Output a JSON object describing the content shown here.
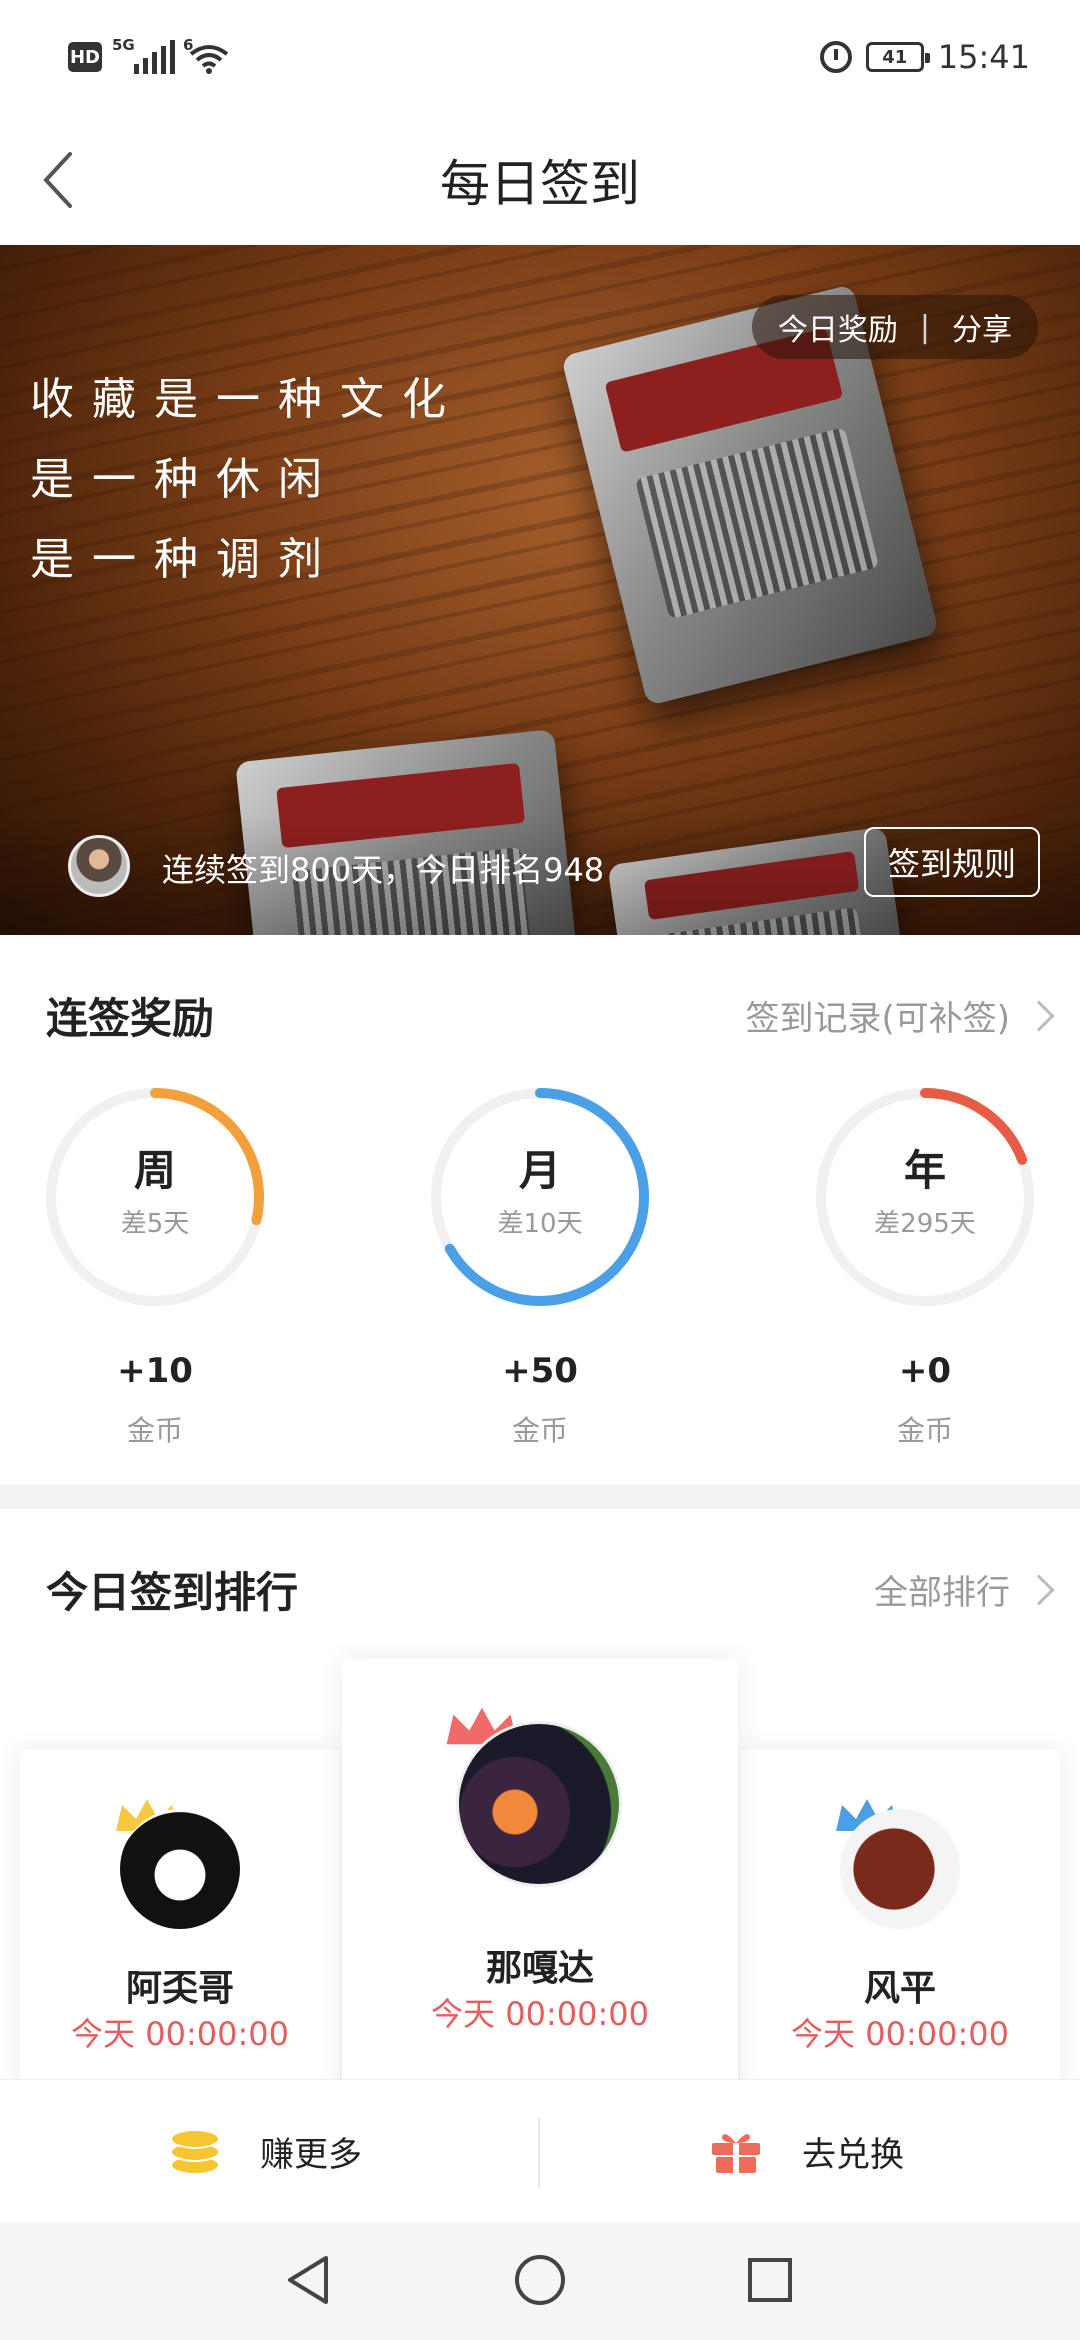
{
  "status_bar": {
    "hd": "HD",
    "signal_tag": "5G",
    "wifi_tag": "6",
    "battery": "41",
    "time": "15:41",
    "icons": [
      "hd-icon",
      "signal-icon",
      "wifi-icon",
      "alarm-icon",
      "battery-icon"
    ]
  },
  "header": {
    "title": "每日签到",
    "back_icon": "chevron-left-icon"
  },
  "banner": {
    "quote_lines": [
      "收藏是一种文化",
      "是一种休闲",
      "是一种调剂"
    ],
    "today_reward": "今日奖励",
    "divider": "|",
    "share": "分享",
    "streak_text": "连续签到800天，今日排名948",
    "rules_button": "签到规则"
  },
  "rewards": {
    "title": "连签奖励",
    "record_link": "签到记录(可补签)",
    "items": [
      {
        "period": "周",
        "remaining": "差5天",
        "coins": "+10",
        "unit": "金币",
        "color": "#f3a03c",
        "progress": 0.2857
      },
      {
        "period": "月",
        "remaining": "差10天",
        "coins": "+50",
        "unit": "金币",
        "color": "#4a9fe6",
        "progress": 0.6667
      },
      {
        "period": "年",
        "remaining": "差295天",
        "coins": "+0",
        "unit": "金币",
        "color": "#e85c46",
        "progress": 0.1918
      }
    ]
  },
  "ranking": {
    "title": "今日签到排行",
    "all_link": "全部排行",
    "entries": [
      {
        "rank": 2,
        "name": "阿奀哥",
        "time": "今天 00:00:00",
        "crown_color": "#f6c93f"
      },
      {
        "rank": 1,
        "name": "那嘎达",
        "time": "今天 00:00:00",
        "crown_color": "#f06a6a"
      },
      {
        "rank": 3,
        "name": "风平",
        "time": "今天 00:00:00",
        "crown_color": "#4a9fe6"
      }
    ]
  },
  "actions": {
    "earn_more": "赚更多",
    "exchange": "去兑换",
    "earn_icon": "coin-stack-icon",
    "exchange_icon": "gift-icon",
    "earn_color": "#f7c531",
    "exchange_color": "#ee6b5a"
  },
  "nav_bar": {
    "icons": [
      "nav-back-icon",
      "nav-home-icon",
      "nav-recents-icon"
    ]
  }
}
